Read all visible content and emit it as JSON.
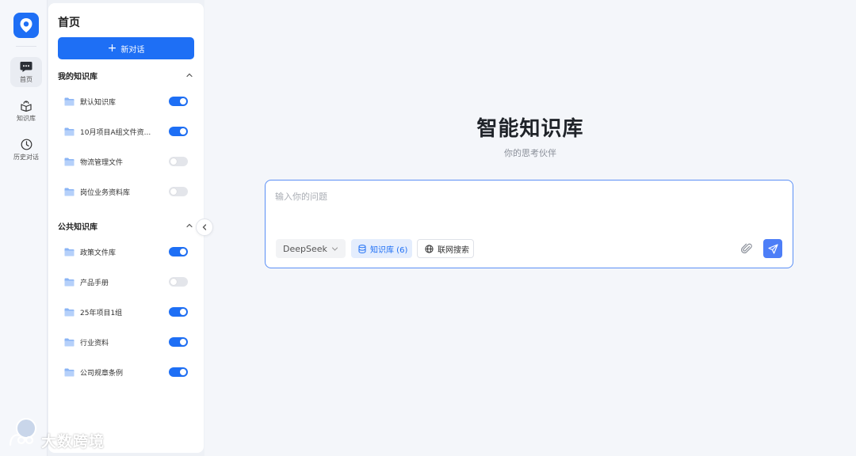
{
  "rail": {
    "items": [
      {
        "label": "首页",
        "icon": "chat-bubble-icon",
        "active": true
      },
      {
        "label": "知识库",
        "icon": "knowledge-box-icon",
        "active": false
      },
      {
        "label": "历史对话",
        "icon": "clock-icon",
        "active": false
      }
    ]
  },
  "panel": {
    "title": "首页",
    "new_chat_label": "新对话",
    "my_kb": {
      "title": "我的知识库",
      "items": [
        {
          "name": "默认知识库",
          "enabled": true
        },
        {
          "name": "10月项目A组文件资...",
          "enabled": true
        },
        {
          "name": "物流管理文件",
          "enabled": false
        },
        {
          "name": "岗位业务资料库",
          "enabled": false
        }
      ]
    },
    "public_kb": {
      "title": "公共知识库",
      "items": [
        {
          "name": "政策文件库",
          "enabled": true
        },
        {
          "name": "产品手册",
          "enabled": false
        },
        {
          "name": "25年项目1组",
          "enabled": true
        },
        {
          "name": "行业资料",
          "enabled": true
        },
        {
          "name": "公司规章条例",
          "enabled": true
        }
      ]
    }
  },
  "main": {
    "title": "智能知识库",
    "subtitle": "你的思考伙伴",
    "input": {
      "placeholder": "输入你的问题",
      "value": ""
    },
    "model_chip": "DeepSeek",
    "kb_chip": "知识库 (6)",
    "web_chip": "联网搜索"
  },
  "watermark": "大数跨境",
  "colors": {
    "accent": "#1e6ff5",
    "send": "#4d7ef7",
    "toggle_off": "#e3e5ea"
  }
}
